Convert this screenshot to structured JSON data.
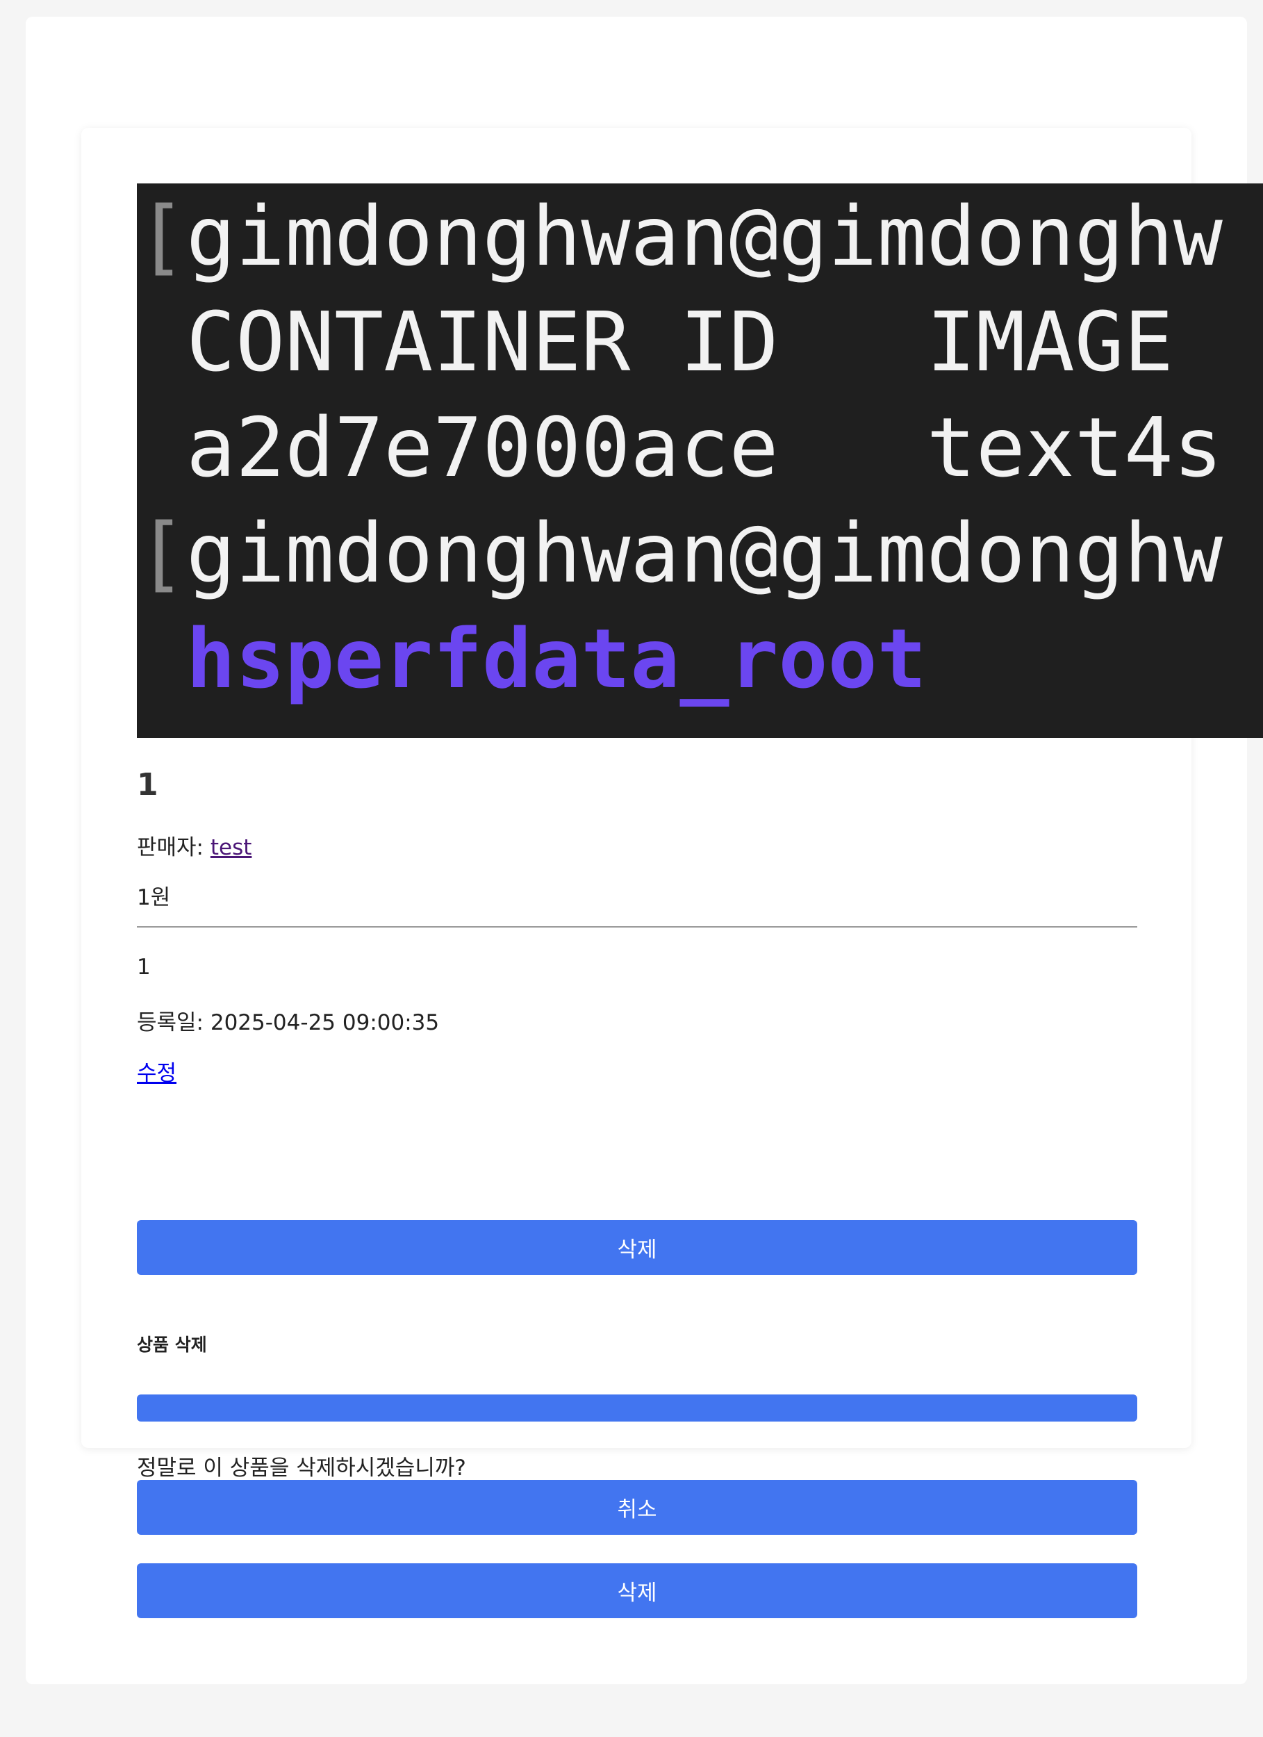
{
  "terminal": {
    "lines": [
      {
        "bracket": "[",
        "text": "gimdonghwan@gimdonghw"
      },
      {
        "bracket": "",
        "text": " CONTAINER ID   IMAGE"
      },
      {
        "bracket": "",
        "text": " a2d7e7000ace   text4s"
      },
      {
        "bracket": "[",
        "text": "gimdonghwan@gimdonghw"
      },
      {
        "bracket": "",
        "text": " hsperfdata_root"
      }
    ],
    "colors": {
      "background": "#1f1f1f",
      "text": "#f2f2f2",
      "highlight": "#6b46f0"
    }
  },
  "product": {
    "title": "1",
    "seller_label": "판매자: ",
    "seller_name": "test",
    "price": "1원",
    "description": "1",
    "date": "등록일: 2025-04-25 09:00:35",
    "edit_label": "수정",
    "delete_label": "삭제"
  },
  "modal": {
    "title": "상품 삭제",
    "message": "정말로 이 상품을 삭제하시겠습니까?",
    "cancel_label": "취소",
    "delete_label": "삭제"
  },
  "colors": {
    "accent": "#4275f0",
    "link": "#0000ee",
    "visited_link": "#4b1677"
  }
}
